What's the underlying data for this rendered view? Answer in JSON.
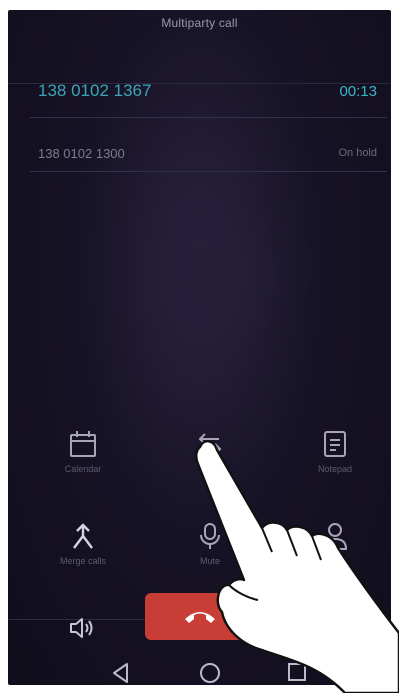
{
  "header": {
    "title": "Multiparty call"
  },
  "calls": [
    {
      "number": "138 0102 1367",
      "status": "00:13"
    },
    {
      "number": "138 0102 1300",
      "status": "On hold"
    }
  ],
  "controls": {
    "calendar_label": "Calendar",
    "notepad_label": "Notepad",
    "merge_label": "Merge calls",
    "mute_label": "Mute"
  },
  "colors": {
    "accent": "#38b7c9",
    "end_call": "#c83d36",
    "background": "#171326"
  },
  "icons": [
    "calendar-icon",
    "swap-calls-icon",
    "notepad-icon",
    "merge-calls-icon",
    "microphone-icon",
    "contact-icon",
    "speaker-icon",
    "end-call-icon",
    "nav-back-icon",
    "nav-home-icon",
    "nav-recent-icon"
  ]
}
